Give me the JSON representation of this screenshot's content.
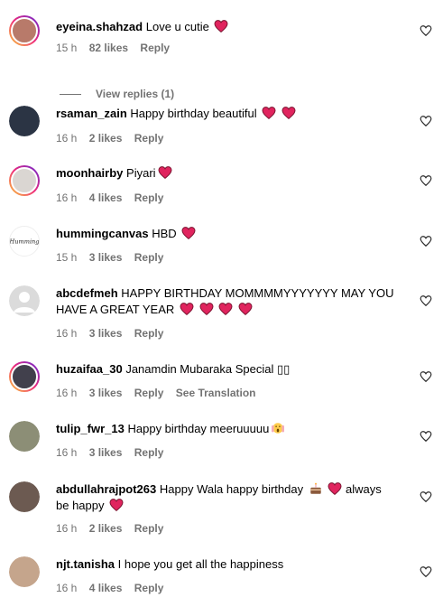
{
  "icons": {
    "like": "heart-outline-icon"
  },
  "comments": [
    {
      "user": "eyeina.shahzad",
      "text": "Love u cutie",
      "time": "15 h",
      "likes": "82 likes",
      "reply": "Reply",
      "avatar_color": "#b87a6a"
    },
    {
      "user": "rsaman_zain",
      "text": "Happy birthday beautiful",
      "time": "16 h",
      "likes": "2 likes",
      "reply": "Reply",
      "avatar_color": "#2b3444"
    },
    {
      "user": "moonhairby",
      "text": "Piyari",
      "time": "16 h",
      "likes": "4 likes",
      "reply": "Reply",
      "avatar_color": "#dad6d2"
    },
    {
      "user": "hummingcanvas",
      "text": "HBD",
      "time": "15 h",
      "likes": "3 likes",
      "reply": "Reply",
      "avatar_color": "#ffffff",
      "avatar_logo": "Humming"
    },
    {
      "user": "abcdefmeh",
      "text": "HAPPY BIRTHDAY MOMMMMYYYYYYY MAY YOU HAVE A GREAT YEAR",
      "time": "16 h",
      "likes": "3 likes",
      "reply": "Reply",
      "avatar_color": "#c8cbd0"
    },
    {
      "user": "huzaifaa_30",
      "text": "Janamdin Mubaraka Special ▯▯",
      "time": "16 h",
      "likes": "3 likes",
      "reply": "Reply",
      "translation": "See Translation",
      "avatar_color": "#41404c"
    },
    {
      "user": "tulip_fwr_13",
      "text": "Happy birthday meeruuuuu",
      "time": "16 h",
      "likes": "3 likes",
      "reply": "Reply",
      "avatar_color": "#8c8e76"
    },
    {
      "user": "abdullahrajpot263",
      "text": "Happy Wala happy birthday",
      "text2": "always be happy",
      "time": "16 h",
      "likes": "2 likes",
      "reply": "Reply",
      "avatar_color": "#6c5a51"
    },
    {
      "user": "njt.tanisha",
      "text": "I hope you get all the happiness",
      "time": "16 h",
      "likes": "4 likes",
      "reply": "Reply",
      "avatar_color": "#c5a58c"
    }
  ],
  "view_replies": "View replies (1)"
}
